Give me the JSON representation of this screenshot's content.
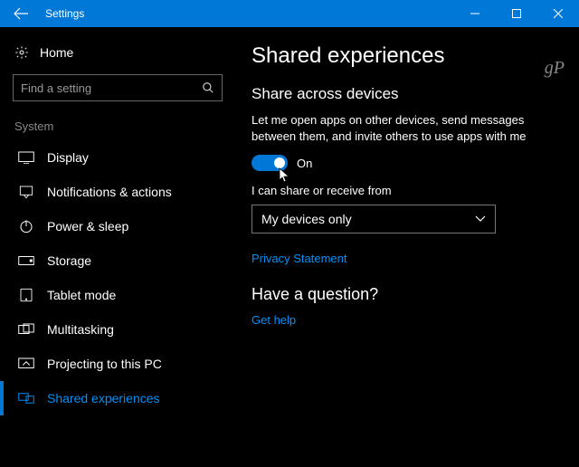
{
  "titlebar": {
    "title": "Settings"
  },
  "sidebar": {
    "home": "Home",
    "search_placeholder": "Find a setting",
    "group": "System",
    "items": [
      {
        "label": "Display"
      },
      {
        "label": "Notifications & actions"
      },
      {
        "label": "Power & sleep"
      },
      {
        "label": "Storage"
      },
      {
        "label": "Tablet mode"
      },
      {
        "label": "Multitasking"
      },
      {
        "label": "Projecting to this PC"
      },
      {
        "label": "Shared experiences"
      }
    ]
  },
  "content": {
    "heading": "Shared experiences",
    "sub1": "Share across devices",
    "desc": "Let me open apps on other devices, send messages between them, and invite others to use apps with me",
    "toggle_state": "On",
    "share_label": "I can share or receive from",
    "select_value": "My devices only",
    "privacy_link": "Privacy Statement",
    "question_heading": "Have a question?",
    "help_link": "Get help"
  },
  "watermark": "gP"
}
